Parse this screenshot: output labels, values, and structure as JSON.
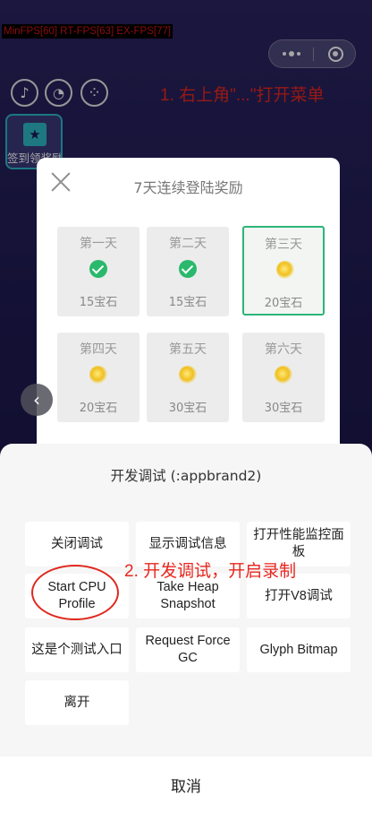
{
  "fps_overlay": "MinFPS[60] RT-FPS[63] EX-FPS[77]",
  "capsule": {
    "more_icon": "more-dots-icon",
    "close_icon": "target-close-icon"
  },
  "top_buttons": [
    {
      "icon": "music-note-icon",
      "glyph": "♪"
    },
    {
      "icon": "chat-bubble-icon",
      "glyph": "◔"
    },
    {
      "icon": "grid-dots-icon",
      "glyph": "⁘"
    }
  ],
  "annotation_1": "1. 右上角\"...\"打开菜单",
  "signin": {
    "label": "签到领奖励",
    "icon": "calendar-star-icon"
  },
  "reward_dialog": {
    "title": "7天连续登陆奖励",
    "days": [
      {
        "label": "第一天",
        "reward": "15宝石",
        "status": "claimed"
      },
      {
        "label": "第二天",
        "reward": "15宝石",
        "status": "claimed"
      },
      {
        "label": "第三天",
        "reward": "20宝石",
        "status": "current"
      },
      {
        "label": "第四天",
        "reward": "20宝石",
        "status": "pending"
      },
      {
        "label": "第五天",
        "reward": "30宝石",
        "status": "pending"
      },
      {
        "label": "第六天",
        "reward": "30宝石",
        "status": "pending"
      }
    ]
  },
  "debug_sheet": {
    "title": "开发调试 (:appbrand2)",
    "options": [
      "关闭调试",
      "显示调试信息",
      "打开性能监控面板",
      "Start CPU Profile",
      "Take Heap Snapshot",
      "打开V8调试",
      "这是个测试入口",
      "Request Force GC",
      "Glyph Bitmap",
      "离开"
    ],
    "cancel": "取消"
  },
  "annotation_2": "2. 开发调试，开启录制",
  "colors": {
    "accent_red": "#e8271f",
    "success_green": "#2ab96c",
    "selected_border": "#2bb57a"
  }
}
